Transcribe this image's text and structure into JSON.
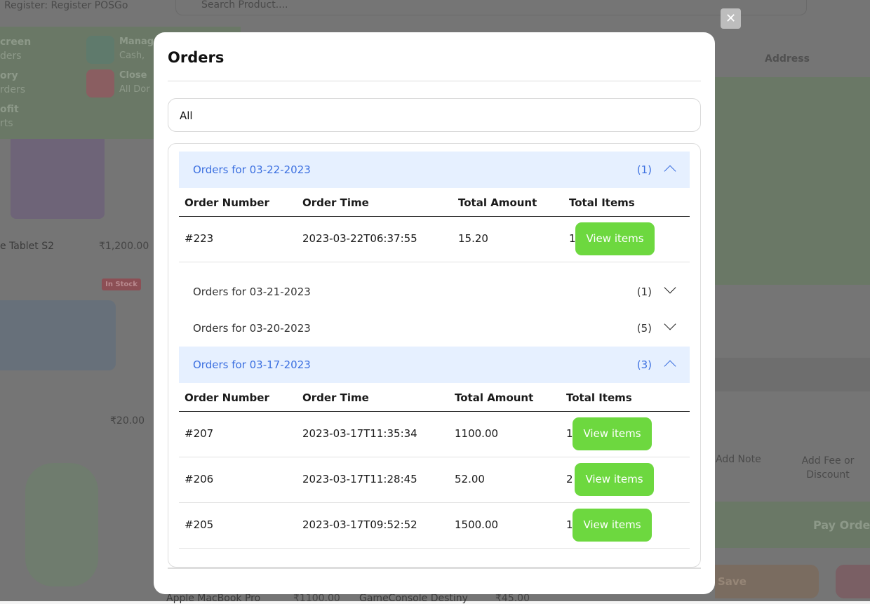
{
  "background": {
    "register": "Register: Register POSGo",
    "search_placeholder": "Search Product....",
    "address": "Address",
    "menu": [
      {
        "t": "creen",
        "s": "ders"
      },
      {
        "t": "ory",
        "s": "rders"
      },
      {
        "t": "ofit",
        "s": "rts"
      },
      {
        "t": "Manag",
        "s": "Cash,"
      },
      {
        "t": "Close",
        "s": "All Dor"
      }
    ],
    "products": [
      {
        "name": "e Tablet S2",
        "price": "₹1,200.00"
      },
      {
        "name": "",
        "price": "₹20.00"
      },
      {
        "name": "Apple MacBook Pro",
        "price": "₹1100.00"
      },
      {
        "name": "GameConsole Destiny",
        "price": "₹45.00"
      }
    ],
    "stock_badge": "In Stock",
    "add_note": "Add Note",
    "add_fee": "Add Fee or Discount",
    "pay_order": "Pay Order",
    "save": "Save"
  },
  "modal": {
    "close_label": "✕",
    "title": "Orders",
    "filter_value": "All",
    "columns": [
      "Order Number",
      "Order Time",
      "Total Amount",
      "Total Items"
    ],
    "view_label": "View items",
    "groups": [
      {
        "label": "Orders for 03-22-2023",
        "count": "(1)",
        "expanded": true,
        "orders": [
          {
            "number": "#223",
            "time": "2023-03-22T06:37:55",
            "amount": "15.20",
            "items": "1"
          }
        ]
      },
      {
        "label": "Orders for 03-21-2023",
        "count": "(1)",
        "expanded": false
      },
      {
        "label": "Orders for 03-20-2023",
        "count": "(5)",
        "expanded": false
      },
      {
        "label": "Orders for 03-17-2023",
        "count": "(3)",
        "expanded": true,
        "orders": [
          {
            "number": "#207",
            "time": "2023-03-17T11:35:34",
            "amount": "1100.00",
            "items": "1"
          },
          {
            "number": "#206",
            "time": "2023-03-17T11:28:45",
            "amount": "52.00",
            "items": "2"
          },
          {
            "number": "#205",
            "time": "2023-03-17T09:52:52",
            "amount": "1500.00",
            "items": "1"
          }
        ]
      }
    ]
  },
  "colors": {
    "accent_blue": "#3b6fe0",
    "header_bg": "#e6f0ff",
    "button_green": "#6dd83f"
  }
}
